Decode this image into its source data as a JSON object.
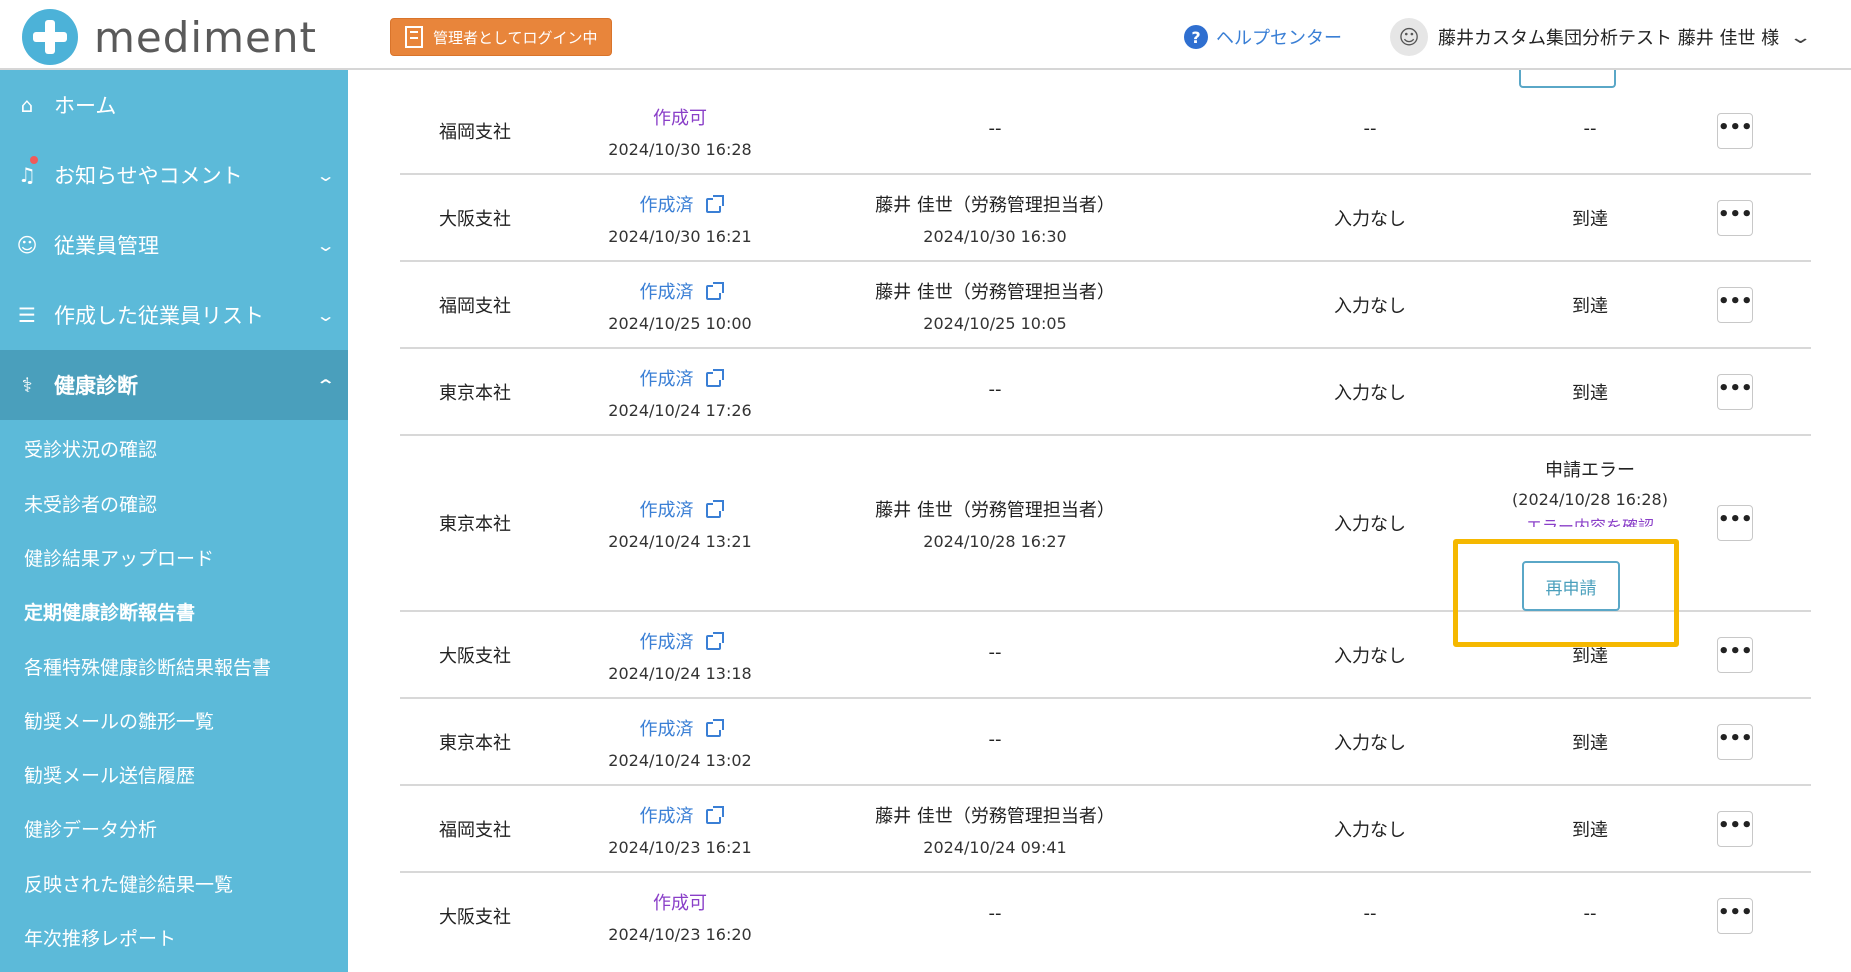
{
  "header": {
    "logo_text": "mediment",
    "admin_badge": "管理者としてログイン中",
    "help_label": "ヘルプセンター",
    "user_name": "藤井カスタム集団分析テスト 藤井 佳世 様"
  },
  "sidebar": {
    "items": [
      {
        "label": "ホーム"
      },
      {
        "label": "お知らせやコメント"
      },
      {
        "label": "従業員管理"
      },
      {
        "label": "作成した従業員リスト"
      },
      {
        "label": "健康診断"
      }
    ],
    "sub_items": [
      {
        "label": "受診状況の確認"
      },
      {
        "label": "未受診者の確認"
      },
      {
        "label": "健診結果アップロード"
      },
      {
        "label": "定期健康診断報告書"
      },
      {
        "label": "各種特殊健康診断結果報告書"
      },
      {
        "label": "勧奨メールの雛形一覧"
      },
      {
        "label": "勧奨メール送信履歴"
      },
      {
        "label": "健診データ分析"
      },
      {
        "label": "反映された健診結果一覧"
      },
      {
        "label": "年次推移レポート"
      }
    ]
  },
  "table": {
    "rows": [
      {
        "branch": "福岡支社",
        "status": "作成可",
        "status_date": "2024/10/30 16:28",
        "person": "--",
        "person_date": "",
        "input": "--",
        "arrival": "--"
      },
      {
        "branch": "大阪支社",
        "status": "作成済",
        "status_date": "2024/10/30 16:21",
        "person": "藤井 佳世（労務管理担当者）",
        "person_date": "2024/10/30 16:30",
        "input": "入力なし",
        "arrival": "到達"
      },
      {
        "branch": "福岡支社",
        "status": "作成済",
        "status_date": "2024/10/25 10:00",
        "person": "藤井 佳世（労務管理担当者）",
        "person_date": "2024/10/25 10:05",
        "input": "入力なし",
        "arrival": "到達"
      },
      {
        "branch": "東京本社",
        "status": "作成済",
        "status_date": "2024/10/24 17:26",
        "person": "--",
        "person_date": "",
        "input": "入力なし",
        "arrival": "到達"
      },
      {
        "branch": "東京本社",
        "status": "作成済",
        "status_date": "2024/10/24 13:21",
        "person": "藤井 佳世（労務管理担当者）",
        "person_date": "2024/10/28 16:27",
        "input": "入力なし",
        "arrival": "申請エラー",
        "error_date": "(2024/10/28 16:28)",
        "error_link": "エラー内容を確認",
        "reapply_label": "再申請"
      },
      {
        "branch": "大阪支社",
        "status": "作成済",
        "status_date": "2024/10/24 13:18",
        "person": "--",
        "person_date": "",
        "input": "入力なし",
        "arrival": "到達"
      },
      {
        "branch": "東京本社",
        "status": "作成済",
        "status_date": "2024/10/24 13:02",
        "person": "--",
        "person_date": "",
        "input": "入力なし",
        "arrival": "到達"
      },
      {
        "branch": "福岡支社",
        "status": "作成済",
        "status_date": "2024/10/23 16:21",
        "person": "藤井 佳世（労務管理担当者）",
        "person_date": "2024/10/24 09:41",
        "input": "入力なし",
        "arrival": "到達"
      },
      {
        "branch": "大阪支社",
        "status": "作成可",
        "status_date": "2024/10/23 16:20",
        "person": "--",
        "person_date": "",
        "input": "--",
        "arrival": "--"
      }
    ],
    "more_label": "•••"
  },
  "colors": {
    "sidebar": "#5cbad9",
    "sidebar_active": "#4a9fbc",
    "badge": "#e8853b",
    "link_blue": "#3a7fd5",
    "link_purple": "#8a3fc8",
    "highlight": "#f5b800"
  }
}
